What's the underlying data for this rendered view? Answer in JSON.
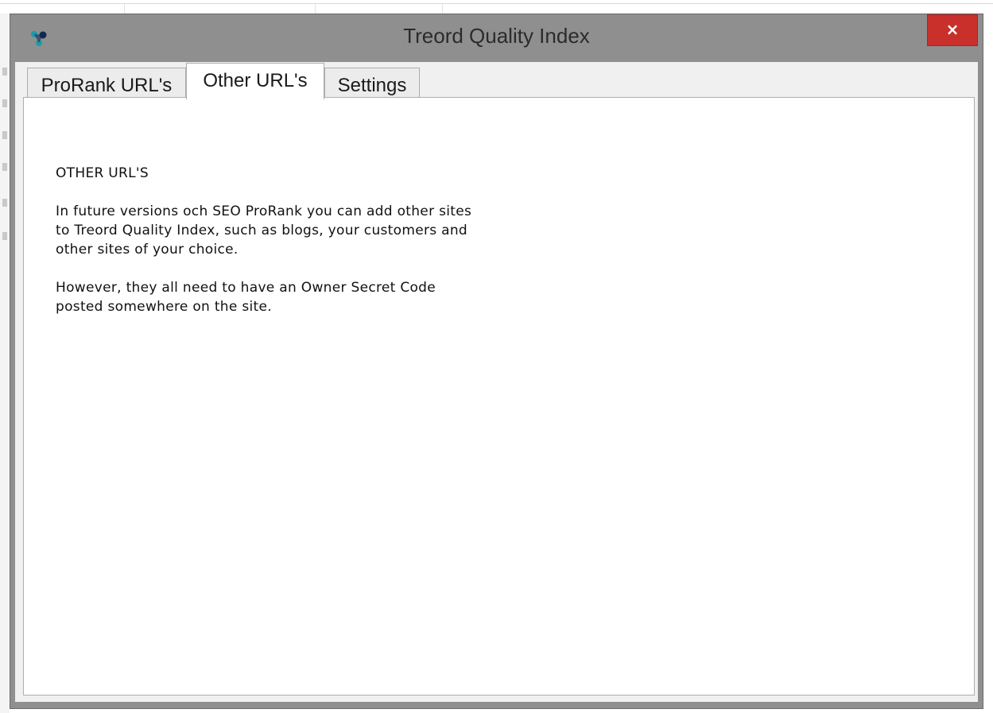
{
  "window": {
    "title": "Treord Quality Index",
    "close_label": "×"
  },
  "tabs": [
    {
      "label": "ProRank URL's",
      "active": false
    },
    {
      "label": "Other URL's",
      "active": true
    },
    {
      "label": "Settings",
      "active": false
    }
  ],
  "content": {
    "heading": "OTHER URL'S",
    "paragraph1_line1": "In future versions och SEO ProRank you can add other sites",
    "paragraph1_line2": "to Treord Quality Index, such as blogs, your customers and",
    "paragraph1_line3": "other sites of your choice.",
    "paragraph2_line1": "However, they all need to have an Owner Secret Code",
    "paragraph2_line2": "posted somewhere on the site."
  },
  "colors": {
    "window_frame": "#8f8f8f",
    "close_button": "#c9302c",
    "icon_teal": "#1f9aa6",
    "icon_dark": "#0d2a52"
  },
  "icons": {
    "app": "treord-logo-icon",
    "close": "close-icon"
  }
}
